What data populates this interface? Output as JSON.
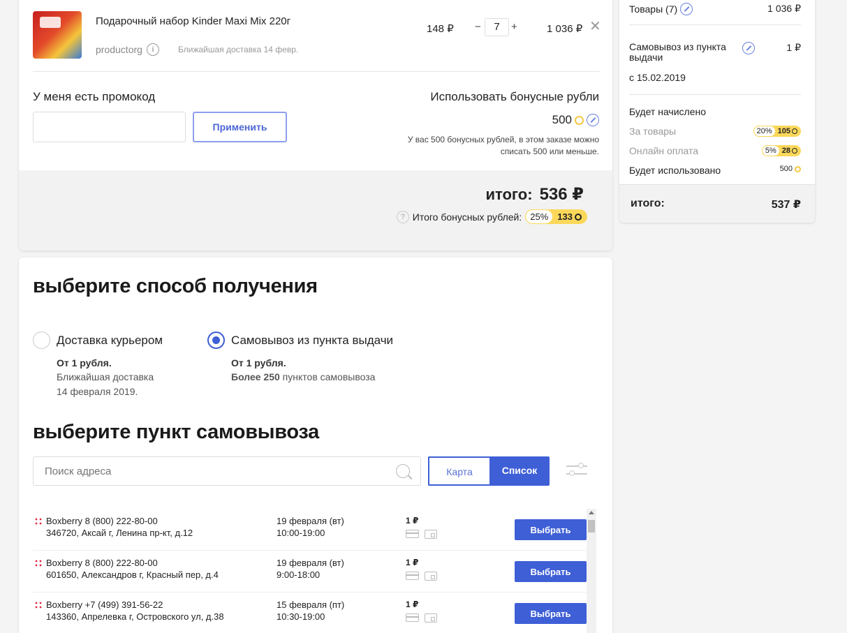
{
  "product": {
    "name": "Подарочный набор Kinder Maxi Mix 220г",
    "seller": "productorg",
    "info_icon": "i",
    "delivery": "Ближайшая доставка 14 февр.",
    "unit_price": "148 ₽",
    "qty_minus": "−",
    "qty": "7",
    "qty_plus": "+",
    "total": "1 036 ₽",
    "remove": "✕"
  },
  "promo": {
    "title": "У меня есть промокод",
    "input_value": "",
    "apply_label": "Применить"
  },
  "bonus": {
    "title": "Использовать бонусные рубли",
    "value": "500",
    "note": "У вас 500 бонусных рублей, в этом заказе можно списать 500 или меньше."
  },
  "totals": {
    "label": "итого:",
    "amount": "536 ₽",
    "bonus_label": "Итого бонусных рублей:",
    "bonus_pct": "25%",
    "bonus_points": "133",
    "help": "?"
  },
  "summary": {
    "goods_label": "Товары (7)",
    "goods_value": "1 036 ₽",
    "pickup_label": "Самовывоз из пункта выдачи",
    "pickup_value": "1 ₽",
    "pickup_date": "с 15.02.2019",
    "accrue_title": "Будет начислено",
    "for_goods_label": "За товары",
    "for_goods_pct": "20%",
    "for_goods_pts": "105",
    "online_label": "Онлайн оплата",
    "online_pct": "5%",
    "online_pts": "28",
    "used_label": "Будет использовано",
    "used_value": "500",
    "total_label": "итого:",
    "total_value": "537 ₽"
  },
  "delivery": {
    "title": "выберите способ получения",
    "courier_label": "Доставка курьером",
    "courier_price": "От 1 рубля.",
    "courier_note_1": "Ближайшая доставка",
    "courier_note_2": "14 февраля 2019.",
    "pickup_label": "Самовывоз из пункта выдачи",
    "pickup_price": "От 1 рубля.",
    "pickup_count": "Более 250",
    "pickup_count_rest": " пунктов самовывоза",
    "selected": "pickup"
  },
  "pickup": {
    "title": "выберите пункт самовывоза",
    "search_placeholder": "Поиск адреса",
    "map_label": "Карта",
    "list_label": "Список",
    "points": [
      {
        "name": "Boxberry 8 (800) 222-80-00",
        "address": "346720, Аксай г, Ленина пр-кт, д.12",
        "date": "19 февраля (вт)",
        "hours": "10:00-19:00",
        "price": "1 ₽",
        "button": "Выбрать"
      },
      {
        "name": "Boxberry 8 (800) 222-80-00",
        "address": "601650, Александров г, Красный пер, д.4",
        "date": "19 февраля (вт)",
        "hours": "9:00-18:00",
        "price": "1 ₽",
        "button": "Выбрать"
      },
      {
        "name": "Boxberry +7 (499) 391-56-22",
        "address": "143360, Апрелевка г, Островского ул, д.38",
        "date": "15 февраля (пт)",
        "hours": "10:30-19:00",
        "price": "1 ₽",
        "button": "Выбрать"
      }
    ]
  },
  "colors": {
    "accent": "#3e5fd6",
    "bonus_yellow": "#fbd85a",
    "brand_red": "#e3213a"
  }
}
